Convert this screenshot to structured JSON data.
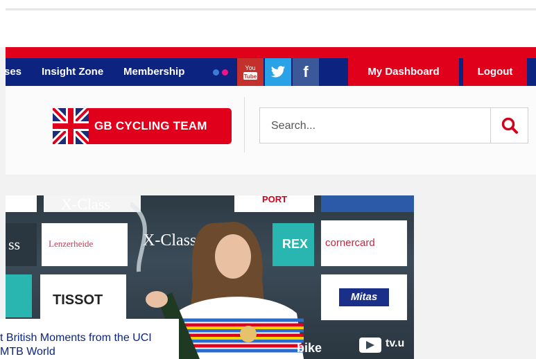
{
  "nav": {
    "items": [
      {
        "label": "ses"
      },
      {
        "label": "Insight Zone"
      },
      {
        "label": "Membership"
      }
    ],
    "social": {
      "flickr_icon": "flickr-icon",
      "youtube_icon": "youtube-icon",
      "youtube_text_top": "You",
      "youtube_text_bottom": "Tube",
      "twitter_icon": "twitter-icon",
      "facebook_icon": "facebook-icon",
      "facebook_glyph": "f"
    },
    "dashboard_label": "My Dashboard",
    "logout_label": "Logout"
  },
  "header": {
    "logo_text": "GB CYCLING TEAM",
    "search": {
      "placeholder": "Search...",
      "button_icon": "search-icon"
    }
  },
  "hero": {
    "sponsors": [
      "X-Class",
      "Lenzerheide",
      "X-Class",
      "TISSOT",
      "cornercard",
      "Mitas",
      "REX",
      "tv.u",
      "bike",
      "PORT",
      "ss"
    ],
    "caption": "t British Moments from the UCI MTB World"
  },
  "colors": {
    "red": "#e0001b",
    "navy": "#0c2480",
    "twitter": "#2aa2e8",
    "facebook": "#3b5998",
    "youtube": "#c4302b"
  }
}
